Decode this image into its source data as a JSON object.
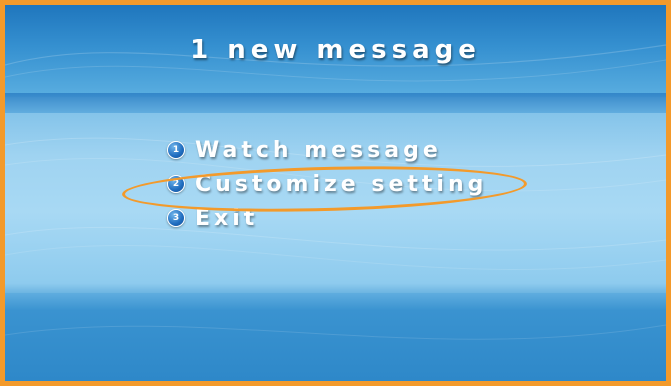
{
  "screen": {
    "title": "1 new message"
  },
  "menu": {
    "items": [
      {
        "number": "1",
        "label": "Watch message"
      },
      {
        "number": "2",
        "label": "Customize setting"
      },
      {
        "number": "3",
        "label": "Exit"
      }
    ],
    "highlighted_item": "Customize setting"
  },
  "colors": {
    "frame_border": "#f39a2b",
    "highlight_ring": "#f39a2b",
    "background_blue": "#4da1d8",
    "text": "#ffffff"
  }
}
